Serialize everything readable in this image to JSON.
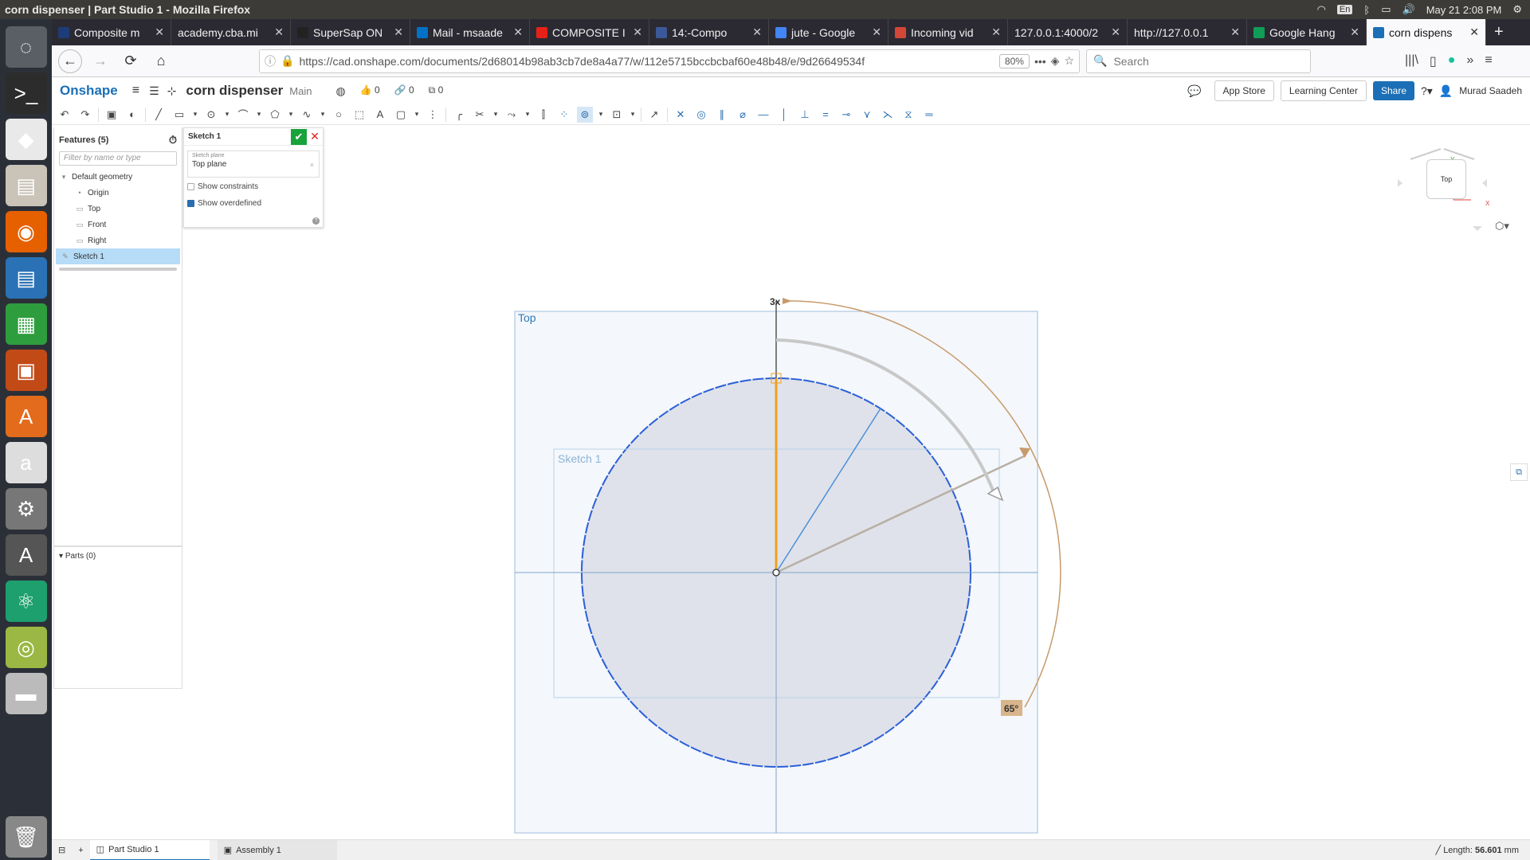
{
  "window": {
    "title": "corn dispenser | Part Studio 1 - Mozilla Firefox",
    "clock": "May 21  2:08 PM",
    "keyboard": "En"
  },
  "launcher": [
    {
      "name": "ubuntu-icon",
      "bg": "#5a5f66"
    },
    {
      "name": "terminal-icon",
      "bg": "#2c2c2c"
    },
    {
      "name": "cube-app-icon",
      "bg": "#e9e9e9"
    },
    {
      "name": "files-icon",
      "bg": "#c9c3b8"
    },
    {
      "name": "firefox-icon",
      "bg": "#e66000"
    },
    {
      "name": "writer-icon",
      "bg": "#2a72b5"
    },
    {
      "name": "calc-icon",
      "bg": "#2e9d3e"
    },
    {
      "name": "impress-icon",
      "bg": "#c24a16"
    },
    {
      "name": "software-center-icon",
      "bg": "#e36b1c"
    },
    {
      "name": "amazon-icon",
      "bg": "#ddd"
    },
    {
      "name": "settings-icon",
      "bg": "#777"
    },
    {
      "name": "updater-icon",
      "bg": "#555"
    },
    {
      "name": "atom-icon",
      "bg": "#1d9f6e"
    },
    {
      "name": "image-viewer-icon",
      "bg": "#9ab843"
    },
    {
      "name": "drive-icon",
      "bg": "#bbb"
    },
    {
      "name": "trash-icon",
      "bg": "#888"
    }
  ],
  "tabs": [
    {
      "label": "Composite m",
      "fav": "#1d3c78"
    },
    {
      "label": "academy.cba.mi",
      "fav": ""
    },
    {
      "label": "SuperSap ON",
      "fav": "#222"
    },
    {
      "label": "Mail - msaade",
      "fav": "#0072c6"
    },
    {
      "label": "COMPOSITE I",
      "fav": "#e62117"
    },
    {
      "label": "14:-Compo",
      "fav": "#3b5998"
    },
    {
      "label": "jute - Google",
      "fav": "#4285f4"
    },
    {
      "label": "Incoming vid",
      "fav": "#d44638"
    },
    {
      "label": "127.0.0.1:4000/2",
      "fav": ""
    },
    {
      "label": "http://127.0.0.1",
      "fav": ""
    },
    {
      "label": "Google Hang",
      "fav": "#0f9d58"
    },
    {
      "label": "corn dispens",
      "fav": "#1b6fb6",
      "active": true
    }
  ],
  "nav": {
    "url": "https://cad.onshape.com/documents/2d68014b98ab3cb7de8a4a77/w/112e5715bccbcbaf60e48b48/e/9d26649534f",
    "zoom": "80%",
    "search_placeholder": "Search"
  },
  "onshape": {
    "logo": "Onshape",
    "doc_name": "corn dispenser",
    "branch": "Main",
    "likes": "0",
    "links": "0",
    "copies": "0",
    "app_store": "App Store",
    "learning_center": "Learning Center",
    "share": "Share",
    "user": "Murad Saadeh"
  },
  "features": {
    "title": "Features (5)",
    "filter_placeholder": "Filter by name or type",
    "default_geometry": "Default geometry",
    "items": [
      "Origin",
      "Top",
      "Front",
      "Right"
    ],
    "sketch": "Sketch 1",
    "parts": "Parts (0)"
  },
  "sketch_dialog": {
    "title": "Sketch 1",
    "plane_label": "Sketch plane",
    "plane_value": "Top plane",
    "show_constraints": "Show constraints",
    "show_overdefined": "Show overdefined"
  },
  "canvas": {
    "plane_label": "Top",
    "sketch_label": "Sketch 1",
    "pattern_count": "3x",
    "angle": "65°",
    "view_cube": "Top",
    "axis_x": "X",
    "axis_y": "Y"
  },
  "bottom": {
    "tab1": "Part Studio 1",
    "tab2": "Assembly 1",
    "length_label": "Length:",
    "length_value": "56.601",
    "length_unit": "mm"
  },
  "colors": {
    "accent": "#1b6fb6",
    "circle": "#2b5fd9",
    "selected_line": "#f0a020",
    "angle_dim": "#c79a6a"
  }
}
